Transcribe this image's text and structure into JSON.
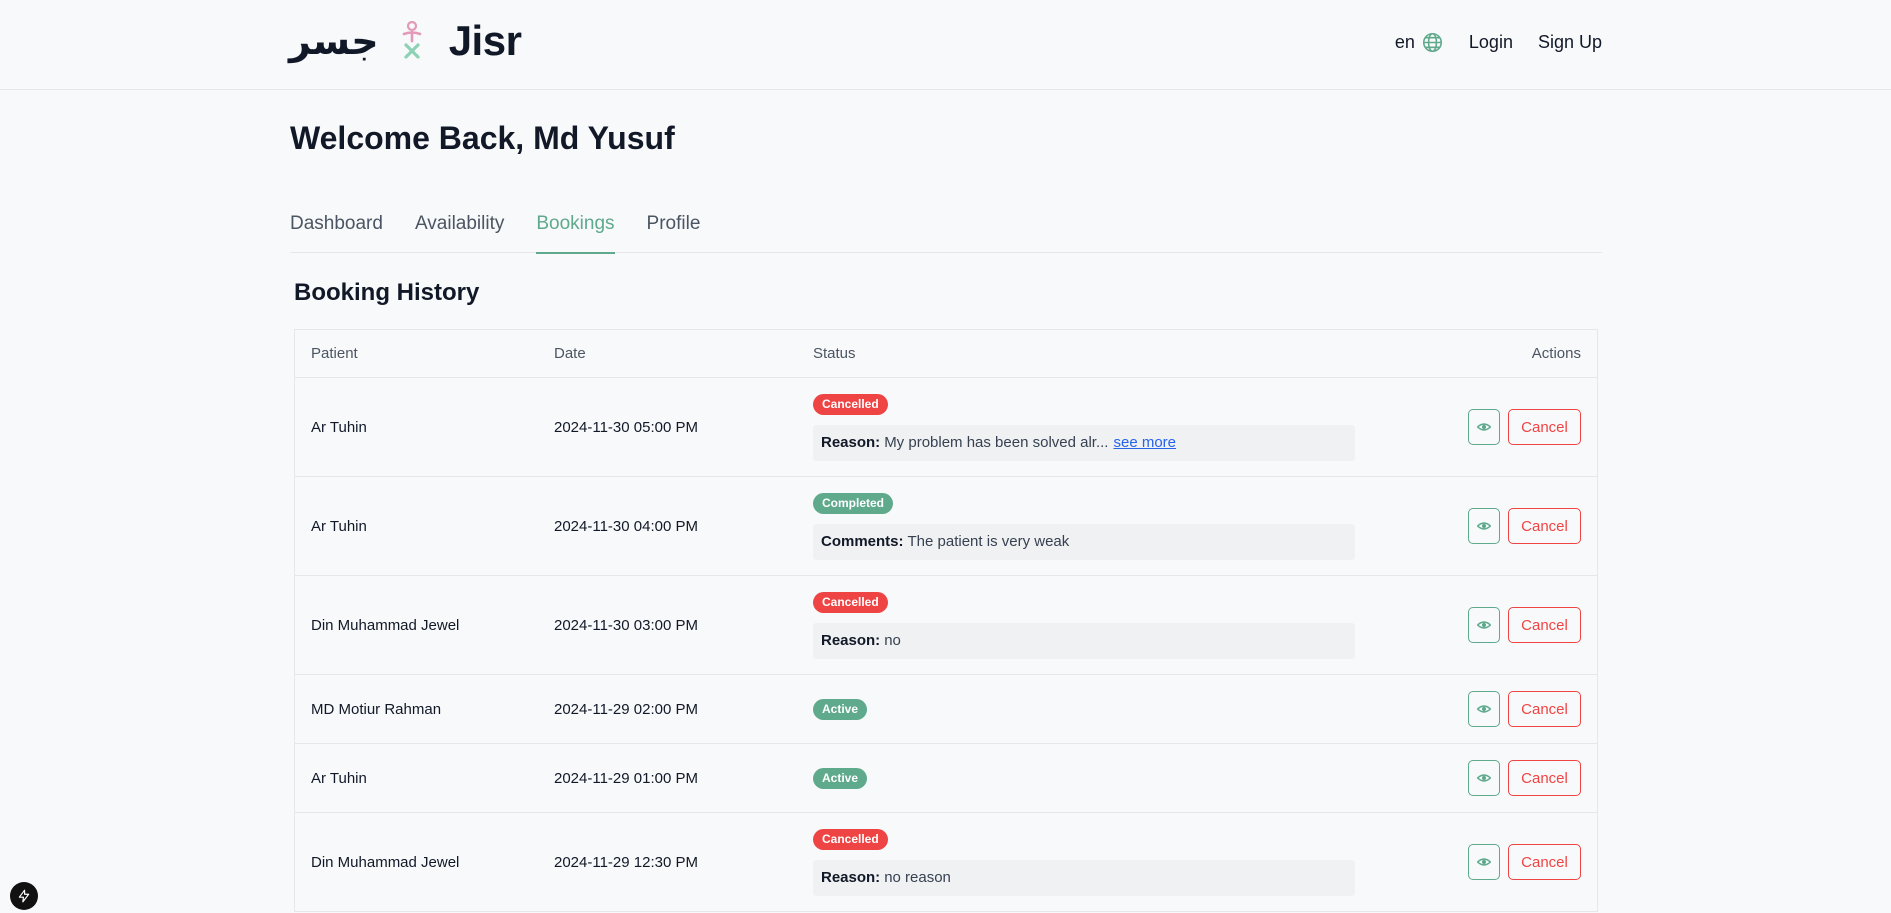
{
  "header": {
    "logo_arabic": "جسر",
    "logo_latin": "Jisr",
    "language": "en",
    "login_label": "Login",
    "signup_label": "Sign Up"
  },
  "welcome": "Welcome Back, Md Yusuf",
  "tabs": [
    {
      "label": "Dashboard",
      "active": false
    },
    {
      "label": "Availability",
      "active": false
    },
    {
      "label": "Bookings",
      "active": true
    },
    {
      "label": "Profile",
      "active": false
    }
  ],
  "section_title": "Booking History",
  "table": {
    "headers": {
      "patient": "Patient",
      "date": "Date",
      "status": "Status",
      "actions": "Actions"
    },
    "cancel_label": "Cancel",
    "rows": [
      {
        "patient": "Ar Tuhin",
        "date": "2024-11-30 05:00 PM",
        "status": "Cancelled",
        "note_label": "Reason:",
        "note_text": "My problem has been solved alr...",
        "note_link": "see more"
      },
      {
        "patient": "Ar Tuhin",
        "date": "2024-11-30 04:00 PM",
        "status": "Completed",
        "note_label": "Comments:",
        "note_text": "The patient is very weak"
      },
      {
        "patient": "Din Muhammad Jewel",
        "date": "2024-11-30 03:00 PM",
        "status": "Cancelled",
        "note_label": "Reason:",
        "note_text": "no"
      },
      {
        "patient": "MD Motiur Rahman",
        "date": "2024-11-29 02:00 PM",
        "status": "Active"
      },
      {
        "patient": "Ar Tuhin",
        "date": "2024-11-29 01:00 PM",
        "status": "Active"
      },
      {
        "patient": "Din Muhammad Jewel",
        "date": "2024-11-29 12:30 PM",
        "status": "Cancelled",
        "note_label": "Reason:",
        "note_text": "no reason"
      }
    ]
  },
  "colors": {
    "brand_green": "#5fa98d",
    "danger_red": "#ef4444",
    "link_blue": "#2563eb"
  },
  "icons": {
    "language": "globe-icon",
    "view": "eye-icon",
    "dev_badge": "lightning-icon"
  }
}
